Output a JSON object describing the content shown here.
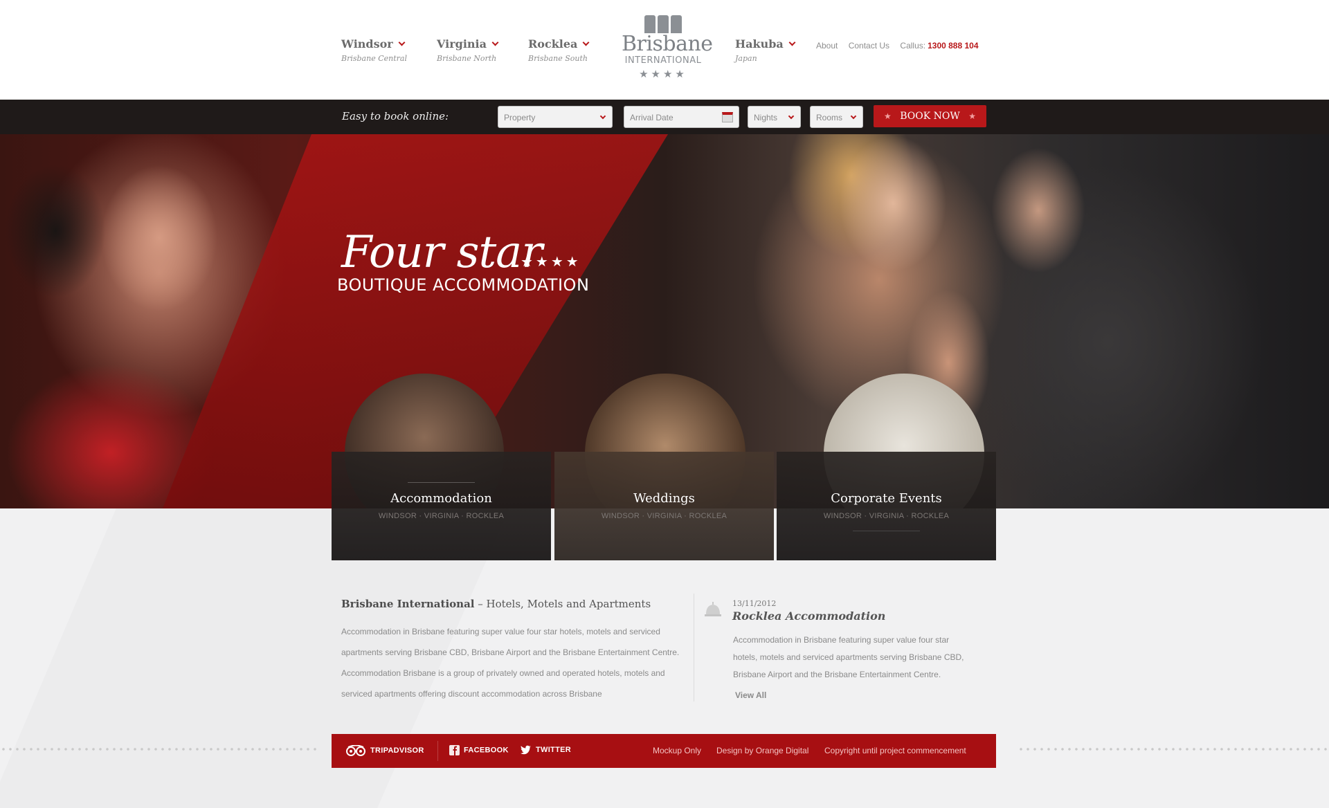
{
  "nav": [
    {
      "name": "Windsor",
      "sub": "Brisbane Central"
    },
    {
      "name": "Virginia",
      "sub": "Brisbane North"
    },
    {
      "name": "Rocklea",
      "sub": "Brisbane South"
    },
    {
      "name": "Hakuba",
      "sub": "Japan"
    }
  ],
  "logo": {
    "title": "Brisbane",
    "sub": "INTERNATIONAL",
    "stars": "★★★★"
  },
  "header_links": {
    "about": "About",
    "contact": "Contact Us",
    "callus_label": "Callus:",
    "phone": "1300 888 104"
  },
  "booking": {
    "label": "Easy to book online:",
    "property": "Property",
    "arrival": "Arrival Date",
    "nights": "Nights",
    "rooms": "Rooms",
    "button": "BOOK NOW",
    "star": "★"
  },
  "hero": {
    "title": "Four star",
    "stars": "★★★★",
    "subtitle": "BOUTIQUE ACCOMMODATION"
  },
  "tiles": [
    {
      "title": "Accommodation",
      "sub": "WINDSOR · VIRGINIA · ROCKLEA"
    },
    {
      "title": "Weddings",
      "sub": "WINDSOR · VIRGINIA · ROCKLEA"
    },
    {
      "title": "Corporate Events",
      "sub": "WINDSOR · VIRGINIA · ROCKLEA"
    }
  ],
  "intro": {
    "title_bold": "Brisbane International",
    "title_rest": " – Hotels, Motels and Apartments",
    "text": "Accommodation in Brisbane featuring super value four star hotels, motels and serviced apartments serving Brisbane CBD, Brisbane Airport and the Brisbane Entertainment Centre. Accommodation Brisbane is a group of privately owned and operated hotels, motels and serviced apartments offering discount accommodation across Brisbane"
  },
  "news": {
    "date": "13/11/2012",
    "title": "Rocklea Accommodation",
    "text": "Accommodation in Brisbane featuring super value four star hotels, motels and serviced apartments serving Brisbane CBD, Brisbane Airport and the Brisbane Entertainment Centre.",
    "view_all": "View All",
    "icon": "bell-icon"
  },
  "footer": {
    "tripadvisor": "TRIPADVISOR",
    "facebook": "FACEBOOK",
    "twitter": "TWITTER",
    "mockup": "Mockup Only",
    "design": "Design by Orange Digital",
    "copyright": "Copyright until project commencement"
  },
  "colors": {
    "accent": "#b8181a",
    "footer": "#a70f12",
    "bookbar": "#1f1a19"
  }
}
